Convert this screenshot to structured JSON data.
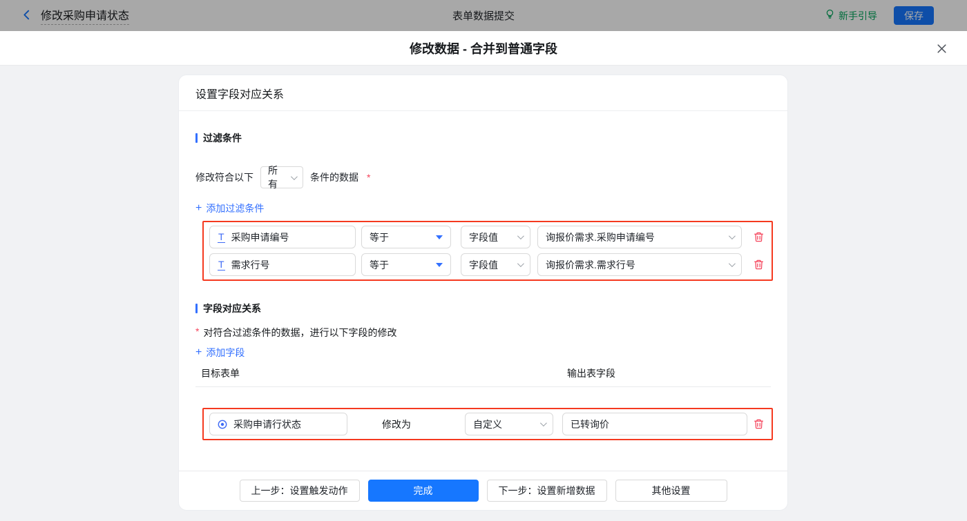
{
  "topbar": {
    "title": "修改采购申请状态",
    "center_title": "表单数据提交",
    "guide_label": "新手引导",
    "save_label": "保存"
  },
  "modal": {
    "title": "修改数据 - 合并到普通字段"
  },
  "card": {
    "header": "设置字段对应关系",
    "required_mark": "*",
    "plus": "+",
    "filter_section": {
      "title": "过滤条件",
      "match_prefix": "修改符合以下",
      "match_select": "所有",
      "match_suffix": "条件的数据",
      "add_link": "添加过滤条件",
      "rows": [
        {
          "field": "采购申请编号",
          "operator": "等于",
          "value_type": "字段值",
          "value": "询报价需求.采购申请编号"
        },
        {
          "field": "需求行号",
          "operator": "等于",
          "value_type": "字段值",
          "value": "询报价需求.需求行号"
        }
      ]
    },
    "mapping_section": {
      "title": "字段对应关系",
      "description": "对符合过滤条件的数据，进行以下字段的修改",
      "add_link": "添加字段",
      "col_target": "目标表单",
      "col_output": "输出表字段",
      "rows": [
        {
          "field": "采购申请行状态",
          "action": "修改为",
          "mode": "自定义",
          "value": "已转询价"
        }
      ]
    },
    "footer": {
      "prev_label": "上一步：设置触发动作",
      "done_label": "完成",
      "next_label": "下一步：设置新增数据",
      "other_label": "其他设置"
    }
  },
  "colors": {
    "accent_blue": "#1677ff",
    "link_blue": "#3370ff",
    "highlight_red": "#f5391f",
    "danger_red": "#f5455c",
    "guide_green": "#00a45a",
    "body_gray": "#f1f2f4"
  }
}
